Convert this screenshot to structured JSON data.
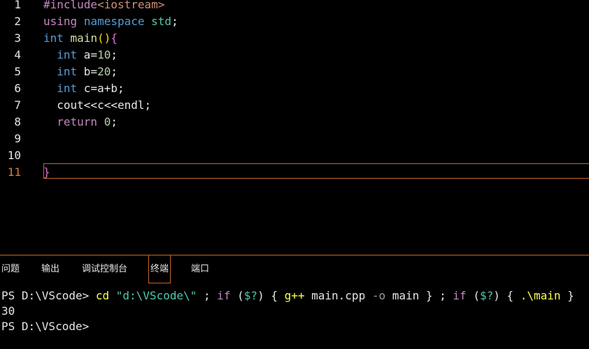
{
  "editor": {
    "line_numbers": [
      "1",
      "2",
      "3",
      "4",
      "5",
      "6",
      "7",
      "8",
      "9",
      "10",
      "11"
    ],
    "lines": [
      [
        {
          "t": "#include",
          "c": "pp"
        },
        {
          "t": "<iostream>",
          "c": "inc"
        }
      ],
      [
        {
          "t": "using",
          "c": "ctl"
        },
        {
          "t": " ",
          "c": "txt"
        },
        {
          "t": "namespace",
          "c": "kw"
        },
        {
          "t": " ",
          "c": "txt"
        },
        {
          "t": "std",
          "c": "ty"
        },
        {
          "t": ";",
          "c": "txt"
        }
      ],
      [
        {
          "t": "int",
          "c": "kw"
        },
        {
          "t": " ",
          "c": "txt"
        },
        {
          "t": "main",
          "c": "fn"
        },
        {
          "t": "()",
          "c": "brace"
        },
        {
          "t": "{",
          "c": "par"
        }
      ],
      [
        {
          "t": "  ",
          "c": "txt"
        },
        {
          "t": "int",
          "c": "kw"
        },
        {
          "t": " a=",
          "c": "txt"
        },
        {
          "t": "10",
          "c": "num"
        },
        {
          "t": ";",
          "c": "txt"
        }
      ],
      [
        {
          "t": "  ",
          "c": "txt"
        },
        {
          "t": "int",
          "c": "kw"
        },
        {
          "t": " b=",
          "c": "txt"
        },
        {
          "t": "20",
          "c": "num"
        },
        {
          "t": ";",
          "c": "txt"
        }
      ],
      [
        {
          "t": "  ",
          "c": "txt"
        },
        {
          "t": "int",
          "c": "kw"
        },
        {
          "t": " c=a+b;",
          "c": "txt"
        }
      ],
      [
        {
          "t": "  cout<<c<<endl;",
          "c": "txt"
        }
      ],
      [
        {
          "t": "  ",
          "c": "txt"
        },
        {
          "t": "return",
          "c": "ctl"
        },
        {
          "t": " ",
          "c": "txt"
        },
        {
          "t": "0",
          "c": "num"
        },
        {
          "t": ";",
          "c": "txt"
        }
      ],
      [],
      [],
      [
        {
          "t": "}",
          "c": "par"
        }
      ]
    ]
  },
  "panel": {
    "tabs": [
      "问题",
      "输出",
      "调试控制台",
      "终端",
      "端口"
    ],
    "active_tab": "终端"
  },
  "terminal": {
    "lines": [
      [
        {
          "t": "PS D:\\VScode> ",
          "c": "t-plain"
        },
        {
          "t": "cd",
          "c": "t-cmd"
        },
        {
          "t": " ",
          "c": "t-plain"
        },
        {
          "t": "\"d:\\VScode\\\"",
          "c": "t-str"
        },
        {
          "t": " ; ",
          "c": "t-plain"
        },
        {
          "t": "if",
          "c": "t-kw"
        },
        {
          "t": " (",
          "c": "t-plain"
        },
        {
          "t": "$?",
          "c": "t-var"
        },
        {
          "t": ") { ",
          "c": "t-plain"
        },
        {
          "t": "g++",
          "c": "t-cmd"
        },
        {
          "t": " main.cpp ",
          "c": "t-plain"
        },
        {
          "t": "-o",
          "c": "t-op"
        },
        {
          "t": " main } ; ",
          "c": "t-plain"
        },
        {
          "t": "if",
          "c": "t-kw"
        },
        {
          "t": " (",
          "c": "t-plain"
        },
        {
          "t": "$?",
          "c": "t-var"
        },
        {
          "t": ") { ",
          "c": "t-plain"
        },
        {
          "t": ".\\main",
          "c": "t-cmd"
        },
        {
          "t": " }",
          "c": "t-plain"
        }
      ],
      [
        {
          "t": "30",
          "c": "t-plain"
        }
      ],
      [
        {
          "t": "PS D:\\VScode>",
          "c": "t-plain"
        }
      ]
    ]
  }
}
